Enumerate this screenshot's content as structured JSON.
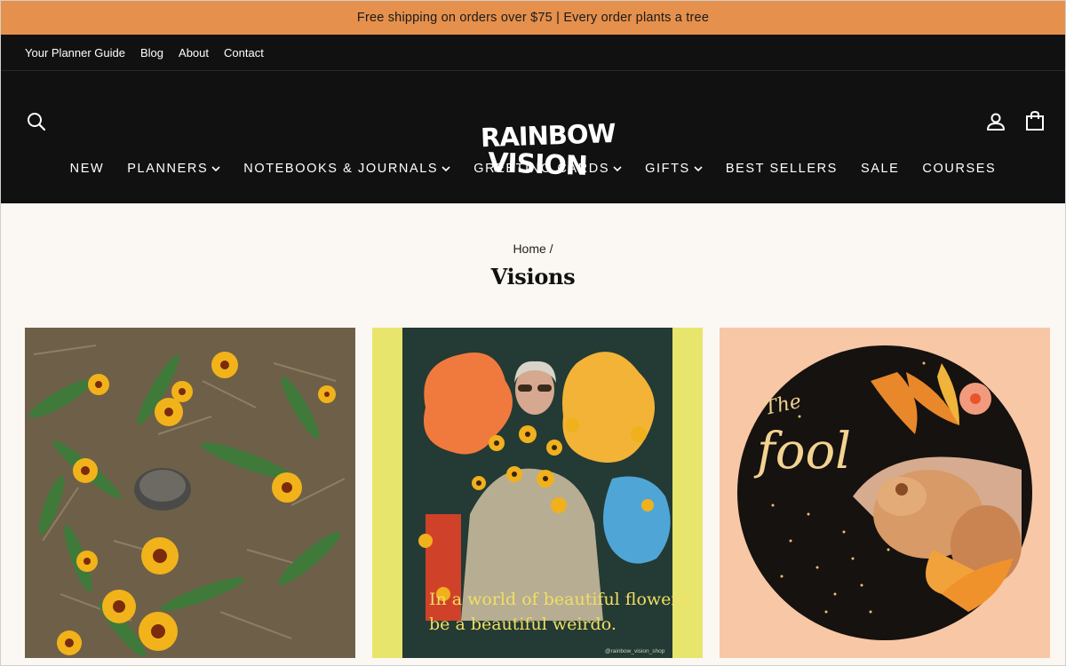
{
  "announcement": "Free shipping on orders over $75 | Every order plants a tree",
  "utility_nav": [
    "Your Planner Guide",
    "Blog",
    "About",
    "Contact"
  ],
  "logo": {
    "line1": "RAINBOW",
    "line2": "VISION"
  },
  "main_nav": [
    {
      "label": "NEW",
      "dropdown": false
    },
    {
      "label": "PLANNERS",
      "dropdown": true
    },
    {
      "label": "NOTEBOOKS & JOURNALS",
      "dropdown": true
    },
    {
      "label": "GREETING CARDS",
      "dropdown": true
    },
    {
      "label": "GIFTS",
      "dropdown": true
    },
    {
      "label": "BEST SELLERS",
      "dropdown": false
    },
    {
      "label": "SALE",
      "dropdown": false
    },
    {
      "label": "COURSES",
      "dropdown": false
    }
  ],
  "breadcrumb": "Home /",
  "page_title": "Visions",
  "tiles": [
    {
      "alt": "garden with yellow daisies"
    },
    {
      "caption_line1": "In a world of beautiful flowers,",
      "caption_line2": "be a beautiful weirdo.",
      "credit": "@rainbow_vision_shop"
    },
    {
      "title_small": "The",
      "title_big": "fool"
    }
  ],
  "colors": {
    "announce_bg": "#e5904c",
    "header_bg": "#111111",
    "page_bg": "#fbf7f2"
  },
  "icons": [
    "search-icon",
    "account-icon",
    "cart-icon",
    "chevron-down-icon"
  ]
}
